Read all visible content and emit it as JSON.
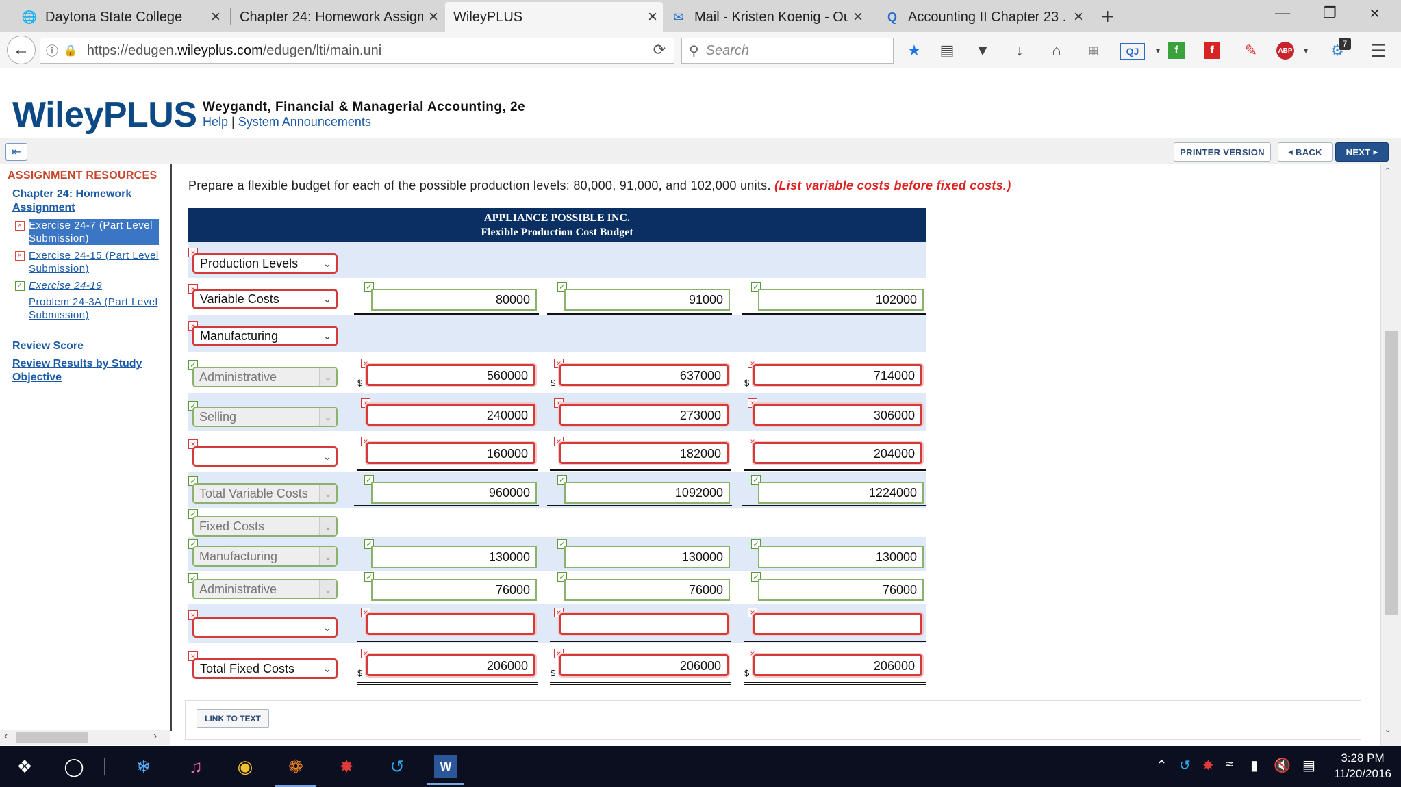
{
  "browser": {
    "tabs": [
      {
        "title": "Daytona State College",
        "icon": "globe-icon"
      },
      {
        "title": "Chapter 24: Homework Assign...",
        "icon": "none"
      },
      {
        "title": "WileyPLUS",
        "icon": "none"
      },
      {
        "title": "Mail - Kristen Koenig - Ou...",
        "icon": "mail-icon"
      },
      {
        "title": "Accounting II Chapter 23 ...",
        "icon": "search-q-icon"
      }
    ],
    "url_prefix": "https://edugen.",
    "url_domain": "wileyplus.com",
    "url_path": "/edugen/lti/main.uni",
    "search_placeholder": "Search",
    "badge_count": "7",
    "abp_label": "ABP",
    "qj_label": "QJ"
  },
  "header": {
    "logo": "WileyPLUS",
    "course": "Weygandt, Financial & Managerial Accounting, 2e",
    "help": "Help",
    "separator": "|",
    "announcements": "System Announcements"
  },
  "toolbar": {
    "printer": "PRINTER VERSION",
    "back": "BACK",
    "next": "NEXT"
  },
  "sidebar": {
    "title": "ASSIGNMENT RESOURCES",
    "chapter": "Chapter 24: Homework Assignment",
    "items": [
      {
        "label": "Exercise 24-7 (Part Level Submission)",
        "status": "incorrect"
      },
      {
        "label": "Exercise 24-15 (Part Level Submission)",
        "status": "incorrect"
      },
      {
        "label": "Exercise 24-19",
        "status": "correct"
      },
      {
        "label": "Problem 24-3A (Part Level Submission)",
        "status": "none"
      }
    ],
    "review_score": "Review Score",
    "review_results": "Review Results by Study Objective"
  },
  "main": {
    "instruction": "Prepare a flexible budget for each of the possible production levels: 80,000, 91,000, and 102,000 units.",
    "instruction_note": "(List variable costs before fixed costs.)",
    "company": "APPLIANCE POSSIBLE INC.",
    "budget_title": "Flexible Production Cost Budget",
    "dollar": "$",
    "rows": [
      {
        "label": "Production Levels",
        "label_ok": false,
        "values": []
      },
      {
        "label": "Variable Costs",
        "label_ok": false,
        "values": [
          "80000",
          "91000",
          "102000"
        ],
        "values_ok": true
      },
      {
        "label": "Manufacturing",
        "label_ok": false,
        "values": []
      },
      {
        "label": "Administrative",
        "label_ok": true,
        "values": [
          "560000",
          "637000",
          "714000"
        ],
        "values_ok": false
      },
      {
        "label": "Selling",
        "label_ok": true,
        "values": [
          "240000",
          "273000",
          "306000"
        ],
        "values_ok": false
      },
      {
        "label": "",
        "label_ok": false,
        "values": [
          "160000",
          "182000",
          "204000"
        ],
        "values_ok": false
      },
      {
        "label": "Total Variable Costs",
        "label_ok": true,
        "values": [
          "960000",
          "1092000",
          "1224000"
        ],
        "values_ok": true
      },
      {
        "label": "Fixed Costs",
        "label_ok": true,
        "values": []
      },
      {
        "label": "Manufacturing",
        "label_ok": true,
        "values": [
          "130000",
          "130000",
          "130000"
        ],
        "values_ok": true
      },
      {
        "label": "Administrative",
        "label_ok": true,
        "values": [
          "76000",
          "76000",
          "76000"
        ],
        "values_ok": true
      },
      {
        "label": "",
        "label_ok": false,
        "values": [
          "",
          "",
          ""
        ],
        "values_ok": false
      },
      {
        "label": "Total Fixed Costs",
        "label_ok": false,
        "values": [
          "206000",
          "206000",
          "206000"
        ],
        "values_ok": false
      }
    ],
    "link_to_text": "LINK TO TEXT"
  },
  "taskbar": {
    "time": "3:28 PM",
    "date": "11/20/2016"
  },
  "colors": {
    "brand_blue": "#0d4a85",
    "table_header": "#0a2f63",
    "incorrect_red": "#d53a3a",
    "correct_green": "#89b36b"
  }
}
